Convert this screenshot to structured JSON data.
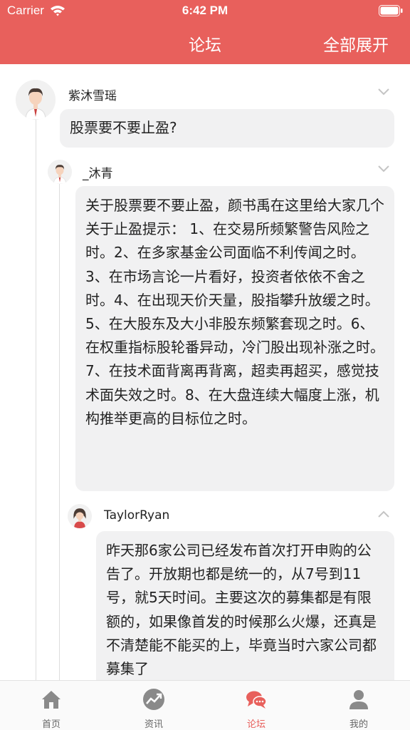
{
  "status_bar": {
    "carrier": "Carrier",
    "time": "6:42 PM"
  },
  "nav": {
    "title": "论坛",
    "expand_all": "全部展开"
  },
  "colors": {
    "accent": "#e8605c",
    "bubble": "#f1f1f2",
    "inactive": "#8a8a8a"
  },
  "posts": [
    {
      "username": "紫沐雪瑶",
      "avatar": "male-avatar",
      "chevron": "chevron-down-icon",
      "text": "股票要不要止盈?"
    },
    {
      "username": "_沐青",
      "avatar": "male-avatar",
      "chevron": "chevron-down-icon",
      "text": "关于股票要不要止盈，颜书禹在这里给大家几个关于止盈提示： 1、在交易所频繁警告风险之时。2、在多家基金公司面临不利传闻之时。3、在市场言论一片看好，投资者依依不舍之时。4、在出现天价天量，股指攀升放缓之时。5、在大股东及大小非股东频繁套现之时。6、在权重指标股轮番异动，冷门股出现补涨之时。7、在技术面背离再背离，超卖再超买，感觉技术面失效之时。8、在大盘连续大幅度上涨，机构推举更高的目标位之时。"
    },
    {
      "username": "TaylorRyan",
      "avatar": "female-avatar",
      "chevron": "chevron-up-icon",
      "text": "昨天那6家公司已经发布首次打开申购的公告了。开放期也都是统一的，从7号到11号，就5天时间。主要这次的募集都是有限额的，如果像首发的时候那么火爆，还真是不清楚能不能买的上，毕竟当时六家公司都募集了"
    }
  ],
  "tabs": [
    {
      "label": "首页",
      "icon": "home-icon",
      "active": false
    },
    {
      "label": "资讯",
      "icon": "trend-icon",
      "active": false
    },
    {
      "label": "论坛",
      "icon": "chat-icon",
      "active": true
    },
    {
      "label": "我的",
      "icon": "user-icon",
      "active": false
    }
  ]
}
